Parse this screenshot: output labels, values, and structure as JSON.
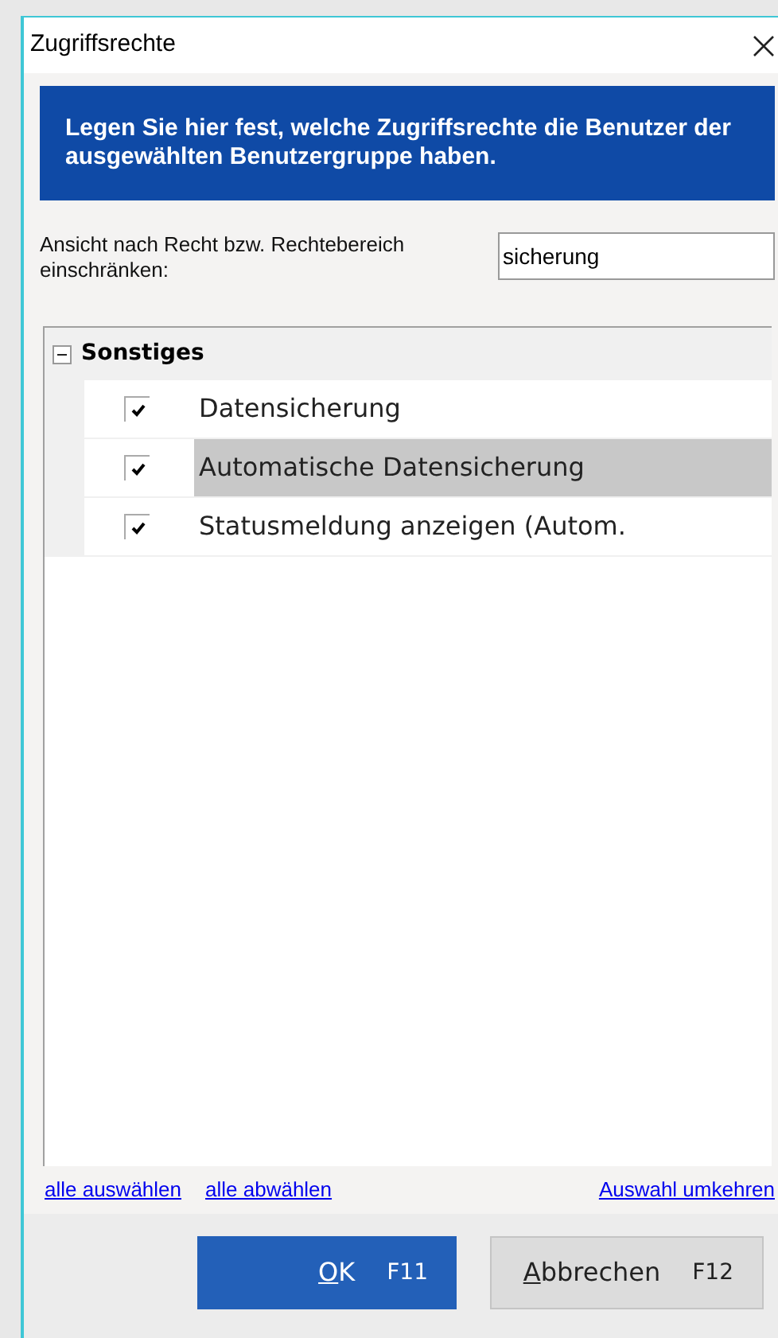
{
  "window": {
    "title": "Zugriffsrechte"
  },
  "banner": "Legen Sie hier fest, welche Zugriffsrechte die Benutzer der ausgewählten Benutzergruppe haben.",
  "filter": {
    "label": "Ansicht nach Recht bzw. Rechtebereich einschränken:",
    "value": "sicherung"
  },
  "tree": [
    {
      "label": "Sonstiges",
      "expanded": true,
      "children": [
        {
          "label": "Datensicherung",
          "checked": true,
          "selected": false
        },
        {
          "label": "Automatische Datensicherung",
          "checked": true,
          "selected": true
        },
        {
          "label": "Statusmeldung anzeigen (Autom.",
          "checked": true,
          "selected": false
        }
      ]
    }
  ],
  "links": [
    "alle auswählen",
    "alle abwählen",
    "Auswahl umkehren"
  ],
  "buttons": [
    {
      "kind": "primary",
      "accel": "O",
      "rest": "K",
      "key": "F11"
    },
    {
      "kind": "secondary",
      "accel": "A",
      "rest": "bbrechen",
      "key": "F12"
    }
  ]
}
